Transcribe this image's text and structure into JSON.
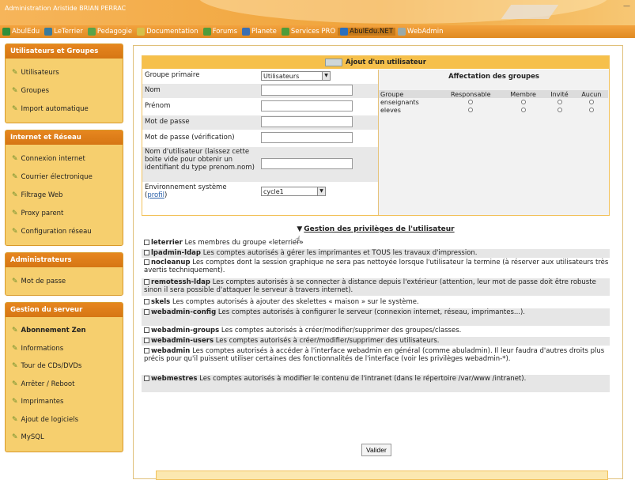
{
  "header": {
    "title": "Administration Aristide BRIAN PERRAC",
    "close_label": "—"
  },
  "topnav": {
    "items": [
      {
        "label": "AbulEdu",
        "icon": "abuledu-icon",
        "color": "#2f8f3a"
      },
      {
        "label": "LeTerrier",
        "icon": "terrier-icon",
        "color": "#3a7a9c"
      },
      {
        "label": "Pedagogie",
        "icon": "pedagogie-icon",
        "color": "#5aa34a"
      },
      {
        "label": "Documentation",
        "icon": "documentation-icon",
        "color": "#d6c04a"
      },
      {
        "label": "Forums",
        "icon": "forums-icon",
        "color": "#4f9c3a"
      },
      {
        "label": "Planete",
        "icon": "planete-icon",
        "color": "#3b6fb3"
      },
      {
        "label": "Services PRO",
        "icon": "services-icon",
        "color": "#4f9c3a"
      },
      {
        "label": "AbulEdu.NET",
        "icon": "abuledunet-icon",
        "color": "#2a6fbf"
      },
      {
        "label": "WebAdmin",
        "icon": "webadmin-icon",
        "color": "#9aa"
      }
    ]
  },
  "sidebar": {
    "sections": [
      {
        "title": "Utilisateurs et Groupes",
        "items": [
          "Utilisateurs",
          "Groupes",
          "Import automatique"
        ]
      },
      {
        "title": "Internet et Réseau",
        "items": [
          "Connexion internet",
          "Courrier électronique",
          "Filtrage Web",
          "Proxy parent",
          "Configuration réseau"
        ]
      },
      {
        "title": "Administrateurs",
        "items": [
          "Mot de passe"
        ]
      },
      {
        "title": "Gestion du serveur",
        "items": [
          "Abonnement Zen",
          "Informations",
          "Tour de CDs/DVDs",
          "Arrêter / Reboot",
          "Imprimantes",
          "Ajout de logiciels",
          "MySQL"
        ]
      }
    ]
  },
  "form": {
    "title": "Ajout d'un utilisateur",
    "primary_group_label": "Groupe primaire",
    "primary_group_value": "Utilisateurs",
    "nom_label": "Nom",
    "prenom_label": "Prénom",
    "password_label": "Mot de passe",
    "password_confirm_label": "Mot de passe (vérification)",
    "username_label": "Nom d'utilisateur (laissez cette boite vide pour obtenir un identifiant du type prenom.nom)",
    "env_label": "Environnement système",
    "env_link": "profil",
    "env_value": "cycle1"
  },
  "groups": {
    "title": "Affectation des groupes",
    "headers": [
      "Groupe",
      "Responsable",
      "Membre",
      "Invité",
      "Aucun"
    ],
    "rows": [
      "enseignants",
      "eleves"
    ]
  },
  "privileges": {
    "title": "Gestion des privilèges de l'utilisateur",
    "items": [
      {
        "name": "leterrier",
        "desc": "Les membres du groupe «leterrier»"
      },
      {
        "name": "lpadmin-ldap",
        "desc": "Les comptes autorisés à gérer les imprimantes et TOUS les travaux d'impression."
      },
      {
        "name": "nocleanup",
        "desc": "Les comptes dont la session graphique ne sera pas nettoyée lorsque l'utilisateur la termine (à réserver aux utilisateurs très avertis techniquement)."
      },
      {
        "name": "remotessh-ldap",
        "desc": "Les comptes autorisés à se connecter à distance depuis l'extérieur (attention, leur mot de passe doit être robuste sinon il sera possible d'attaquer le serveur à travers internet)."
      },
      {
        "name": "skels",
        "desc": "Les comptes autorisés à ajouter des skelettes « maison » sur le système."
      },
      {
        "name": "webadmin-config",
        "desc": "Les comptes autorisés à configurer le serveur (connexion internet, réseau, imprimantes...)."
      },
      {
        "name": "webadmin-groups",
        "desc": "Les comptes autorisés à créer/modifier/supprimer des groupes/classes."
      },
      {
        "name": "webadmin-users",
        "desc": "Les comptes autorisés à créer/modifier/supprimer des utilisateurs."
      },
      {
        "name": "webadmin",
        "desc": "Les comptes autorisés à accéder à l'interface webadmin en général (comme abuladmin). Il leur faudra d'autres droits plus précis pour qu'il puissent utiliser certaines des fonctionnalités de l'interface (voir les privilèges webadmin-*)."
      },
      {
        "name": "webmestres",
        "desc": "Les comptes autorisés à modifier le contenu de l'intranet (dans le répertoire /var/www /intranet)."
      }
    ]
  },
  "submit_label": "Valider"
}
